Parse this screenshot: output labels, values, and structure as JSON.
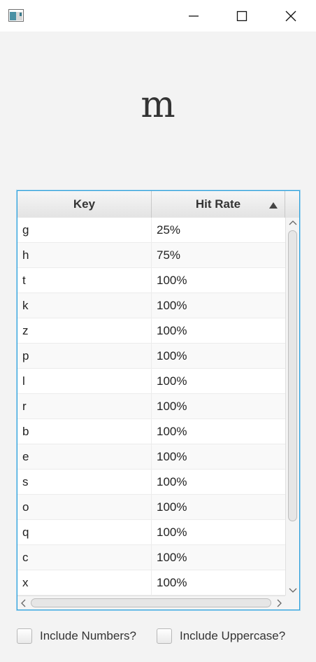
{
  "window": {
    "icons": {
      "app": "app-icon",
      "minimize": "minimize-icon",
      "maximize": "maximize-icon",
      "close": "close-icon"
    }
  },
  "display": {
    "letter": "m"
  },
  "table": {
    "columns": [
      "Key",
      "Hit Rate"
    ],
    "sort": {
      "column": "Hit Rate",
      "direction": "ascending",
      "icon": "sort-ascending-icon"
    },
    "rows": [
      {
        "key": "g",
        "rate": "25%"
      },
      {
        "key": "h",
        "rate": "75%"
      },
      {
        "key": "t",
        "rate": "100%"
      },
      {
        "key": "k",
        "rate": "100%"
      },
      {
        "key": "z",
        "rate": "100%"
      },
      {
        "key": "p",
        "rate": "100%"
      },
      {
        "key": "l",
        "rate": "100%"
      },
      {
        "key": "r",
        "rate": "100%"
      },
      {
        "key": "b",
        "rate": "100%"
      },
      {
        "key": "e",
        "rate": "100%"
      },
      {
        "key": "s",
        "rate": "100%"
      },
      {
        "key": "o",
        "rate": "100%"
      },
      {
        "key": "q",
        "rate": "100%"
      },
      {
        "key": "c",
        "rate": "100%"
      },
      {
        "key": "x",
        "rate": "100%"
      }
    ]
  },
  "options": {
    "include_numbers": {
      "label": "Include Numbers?",
      "checked": false
    },
    "include_uppercase": {
      "label": "Include Uppercase?",
      "checked": false
    }
  },
  "colors": {
    "focus_border": "#2d9fd9",
    "background": "#f3f3f3"
  }
}
